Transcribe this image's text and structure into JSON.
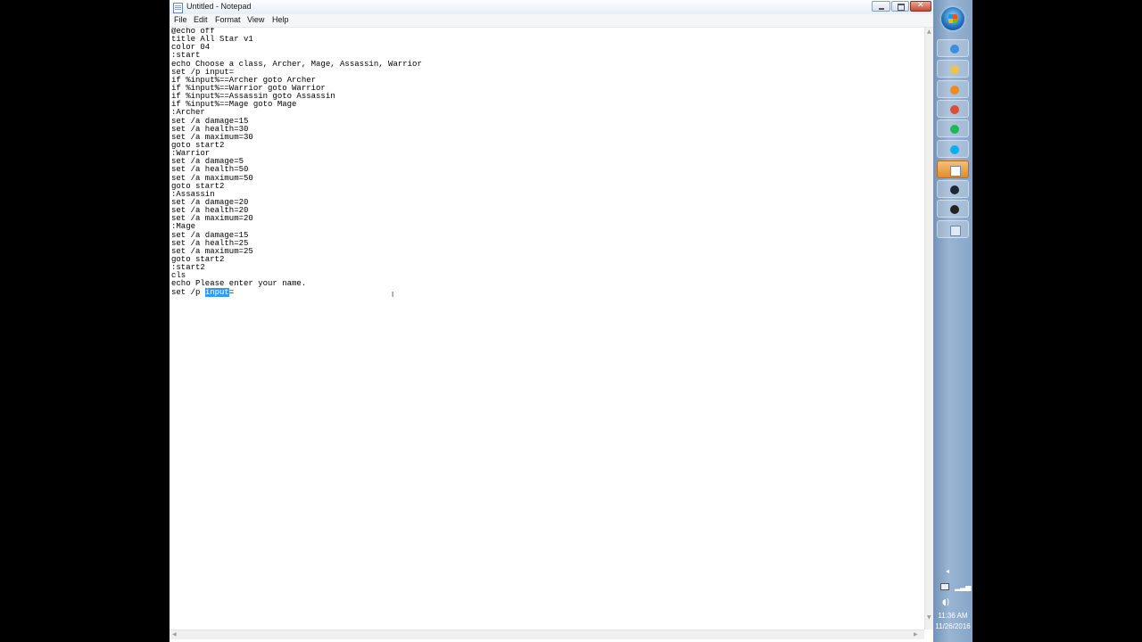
{
  "window": {
    "title": "Untitled - Notepad"
  },
  "menu": [
    "File",
    "Edit",
    "Format",
    "View",
    "Help"
  ],
  "editor": {
    "lines": [
      "@echo off",
      "title All Star v1",
      "color 04",
      ":start",
      "echo Choose a class, Archer, Mage, Assassin, Warrior",
      "set /p input=",
      "if %input%==Archer goto Archer",
      "if %input%==Warrior goto Warrior",
      "if %input%==Assassin goto Assassin",
      "if %input%==Mage goto Mage",
      ":Archer",
      "set /a damage=15",
      "set /a health=30",
      "set /a maximum=30",
      "goto start2",
      ":Warrior",
      "set /a damage=5",
      "set /a health=50",
      "set /a maximum=50",
      "goto start2",
      ":Assassin",
      "set /a damage=20",
      "set /a health=20",
      "set /a maximum=20",
      ":Mage",
      "set /a damage=15",
      "set /a health=25",
      "set /a maximum=25",
      "goto start2",
      ":start2",
      "cls",
      "echo Please enter your name."
    ],
    "last_line_prefix": "set /p ",
    "selected_text": "input",
    "last_line_suffix": "="
  },
  "taskbar": {
    "pinned_icons": [
      {
        "name": "ie-icon",
        "color": "#3a8fe0"
      },
      {
        "name": "explorer-icon",
        "color": "#f0c24a"
      },
      {
        "name": "media-player-icon",
        "color": "#f08a1c"
      },
      {
        "name": "chrome-icon",
        "color": "#dd4b39"
      },
      {
        "name": "spotify-icon",
        "color": "#1db954"
      },
      {
        "name": "skype-icon",
        "color": "#00aff0"
      },
      {
        "name": "notepad-icon",
        "color": "#ffffff"
      },
      {
        "name": "steam-icon",
        "color": "#1b2838"
      },
      {
        "name": "obs-icon",
        "color": "#222222"
      },
      {
        "name": "file-icon",
        "color": "#dfe9f5"
      }
    ],
    "clock_time": "11:36 AM",
    "clock_date": "11/26/2016"
  }
}
